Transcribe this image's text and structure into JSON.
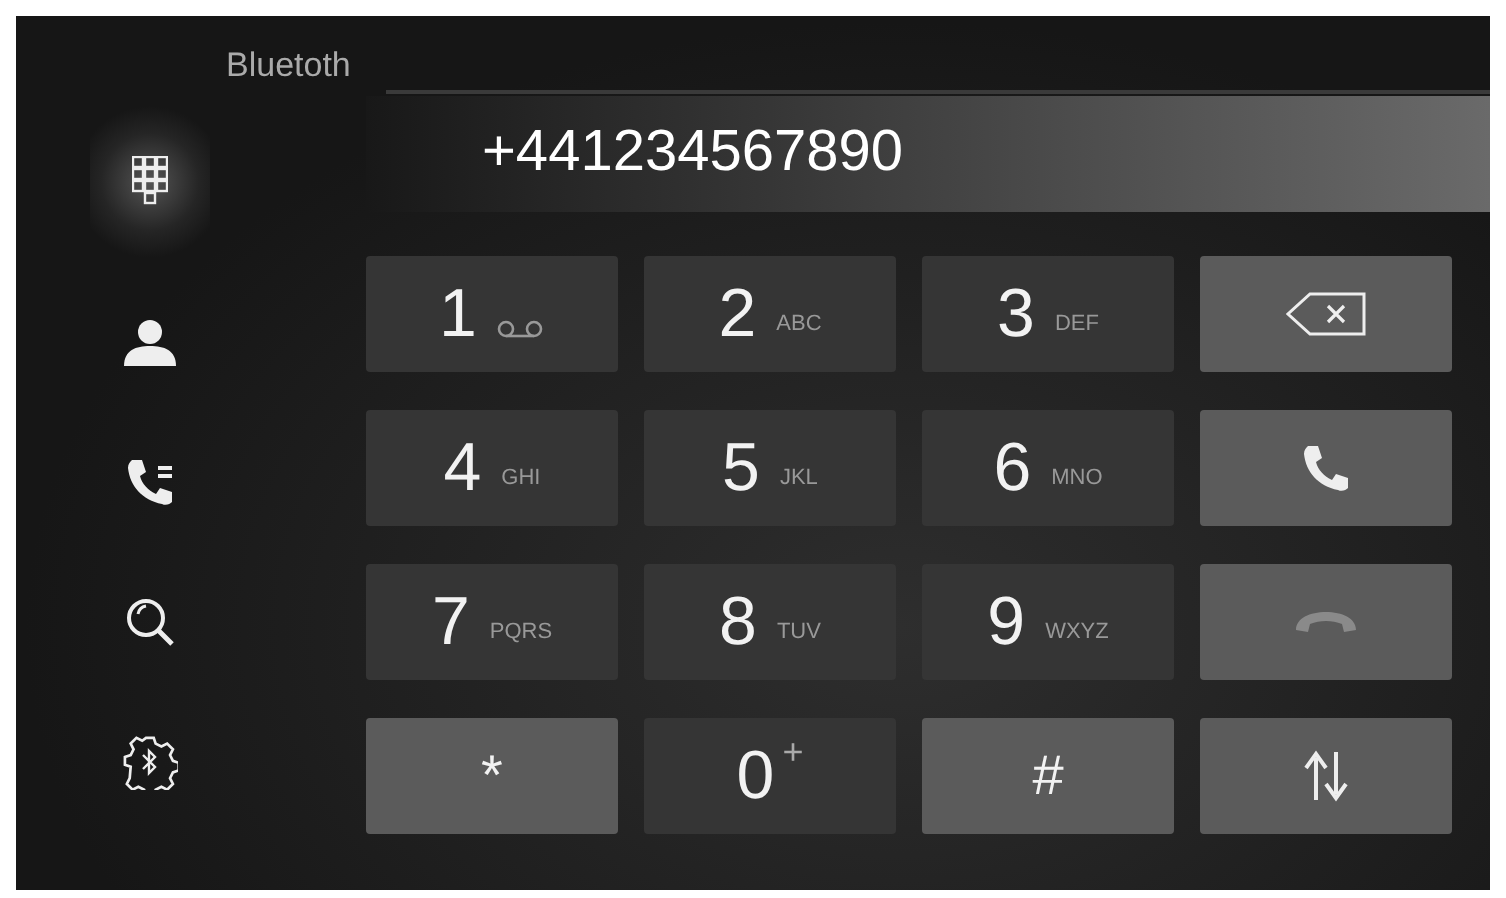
{
  "title": "Bluetoth",
  "number": "+441234567890",
  "sidebar": [
    {
      "kind": "keypad",
      "selected": true
    },
    {
      "kind": "contacts",
      "selected": false
    },
    {
      "kind": "call-history",
      "selected": false
    },
    {
      "kind": "search",
      "selected": false
    },
    {
      "kind": "bluetooth-settings",
      "selected": false
    }
  ],
  "keys": [
    {
      "kind": "digit",
      "digit": "1",
      "voicemail": true
    },
    {
      "kind": "digit",
      "digit": "2",
      "letters": "ABC"
    },
    {
      "kind": "digit",
      "digit": "3",
      "letters": "DEF"
    },
    {
      "kind": "backspace"
    },
    {
      "kind": "digit",
      "digit": "4",
      "letters": "GHI"
    },
    {
      "kind": "digit",
      "digit": "5",
      "letters": "JKL"
    },
    {
      "kind": "digit",
      "digit": "6",
      "letters": "MNO"
    },
    {
      "kind": "call"
    },
    {
      "kind": "digit",
      "digit": "7",
      "letters": "PQRS"
    },
    {
      "kind": "digit",
      "digit": "8",
      "letters": "TUV"
    },
    {
      "kind": "digit",
      "digit": "9",
      "letters": "WXYZ"
    },
    {
      "kind": "end-call"
    },
    {
      "kind": "symbol",
      "digit": "*"
    },
    {
      "kind": "plus",
      "digit": "0",
      "letters": "+"
    },
    {
      "kind": "symbol",
      "digit": "#"
    },
    {
      "kind": "swap"
    }
  ]
}
